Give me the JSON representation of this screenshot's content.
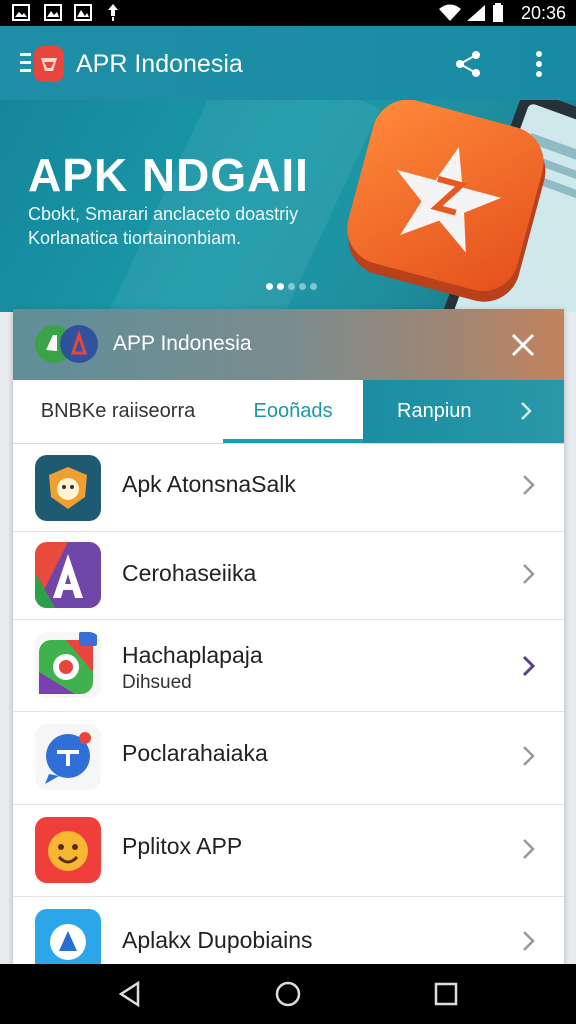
{
  "status_bar": {
    "time": "20:36"
  },
  "app_bar": {
    "title": "APR Indonesia"
  },
  "banner": {
    "title": "APK NDGAII",
    "subtitle_line1": "Cbokt, Smarari anclaceto doastriy",
    "subtitle_line2": "Korlanatica tiortainonbiam.",
    "slides_total": 5,
    "slide_active": 1
  },
  "dialog": {
    "title": "APP Indonesia",
    "tabs": [
      {
        "label": "BNBKe raiiseorra"
      },
      {
        "label": "Eooñads"
      },
      {
        "label": "Ranpiun"
      }
    ],
    "items": [
      {
        "name": "Apk AtonsnaSalk",
        "subtitle": ""
      },
      {
        "name": "Cerohaseiika",
        "subtitle": ""
      },
      {
        "name": "Hachaplapaja",
        "subtitle": "Dihsued"
      },
      {
        "name": "Poclarahaiaka",
        "subtitle": ""
      },
      {
        "name": "Pplitox APP",
        "subtitle": ""
      },
      {
        "name": "Aplakx Dupobiains",
        "subtitle": ""
      }
    ]
  },
  "colors": {
    "primary": "#1b8da5",
    "accent": "#f26a2a",
    "tab_active": "#1a98a8"
  }
}
